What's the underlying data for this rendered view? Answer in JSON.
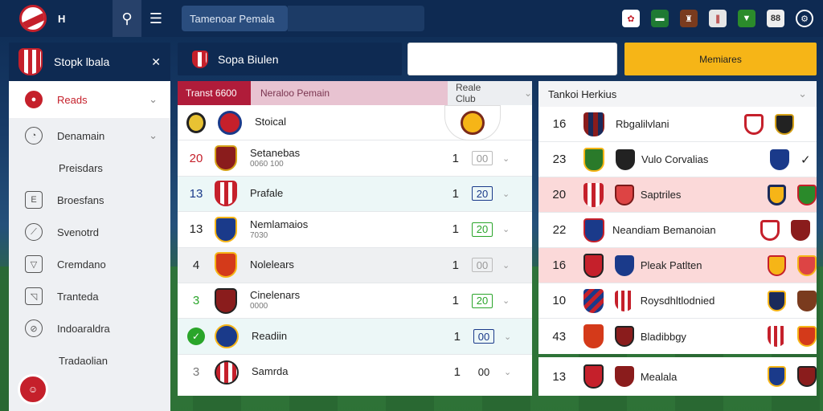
{
  "topbar": {
    "search_value": "Tamenoar Pemala",
    "logo_text": "H"
  },
  "sidebar": {
    "header": "Stopk lbala",
    "items": [
      {
        "label": "Reads",
        "icon": "shield-icon",
        "active": true
      },
      {
        "label": "Denamain",
        "icon": "clock-icon"
      },
      {
        "label": "Preisdars",
        "sub": true
      },
      {
        "label": "Broesfans",
        "icon": "document-icon"
      },
      {
        "label": "Svenotrd",
        "icon": "compass-icon"
      },
      {
        "label": "Cremdano",
        "icon": "shield-outline-icon"
      },
      {
        "label": "Tranteda",
        "icon": "image-icon"
      },
      {
        "label": "Indoaraldra",
        "icon": "clock-slash-icon"
      },
      {
        "label": "Tradaolian",
        "sub": true
      }
    ]
  },
  "toolbar": {
    "title": "Sopa Biulen",
    "button_label": "Memiares"
  },
  "table": {
    "headers": [
      "Transt 6600",
      "Neraloo Pemain",
      "Reale Club"
    ],
    "rows": [
      {
        "rank": "",
        "name": "Stoical",
        "sub": "",
        "score": "",
        "chip": ""
      },
      {
        "rank": "20",
        "name": "Setanebas",
        "sub": "0060 100",
        "score": "1",
        "chip": "00"
      },
      {
        "rank": "13",
        "name": "Prafale",
        "sub": "",
        "score": "1",
        "chip": "20"
      },
      {
        "rank": "13",
        "name": "Nemlamaios",
        "sub": "7030",
        "score": "1",
        "chip": "20"
      },
      {
        "rank": "4",
        "name": "Nolelears",
        "sub": "",
        "score": "1",
        "chip": "00"
      },
      {
        "rank": "3",
        "name": "Cinelenars",
        "sub": "0000",
        "score": "1",
        "chip": "20"
      },
      {
        "rank": "",
        "name": "Readiin",
        "sub": "",
        "score": "1",
        "chip": "00"
      },
      {
        "rank": "3",
        "name": "Samrda",
        "sub": "",
        "score": "1",
        "chip": "00"
      }
    ]
  },
  "right_panel": {
    "header": "Tankoi Herkius",
    "rows": [
      {
        "rank": "16",
        "name": "Rbgalilvlani"
      },
      {
        "rank": "23",
        "name": "Vulo Corvalias"
      },
      {
        "rank": "20",
        "name": "Saptriles"
      },
      {
        "rank": "22",
        "name": "Neandiam Bemanoian"
      },
      {
        "rank": "16",
        "name": "Pleak Patlten"
      },
      {
        "rank": "10",
        "name": "Roysdhltlodnied"
      },
      {
        "rank": "43",
        "name": "Bladibbgy"
      }
    ],
    "footer": {
      "rank": "13",
      "name": "Mealala"
    }
  },
  "colors": {
    "brand_navy": "#0e2a52",
    "accent_red": "#c5202b",
    "button_yellow": "#f6b517"
  }
}
